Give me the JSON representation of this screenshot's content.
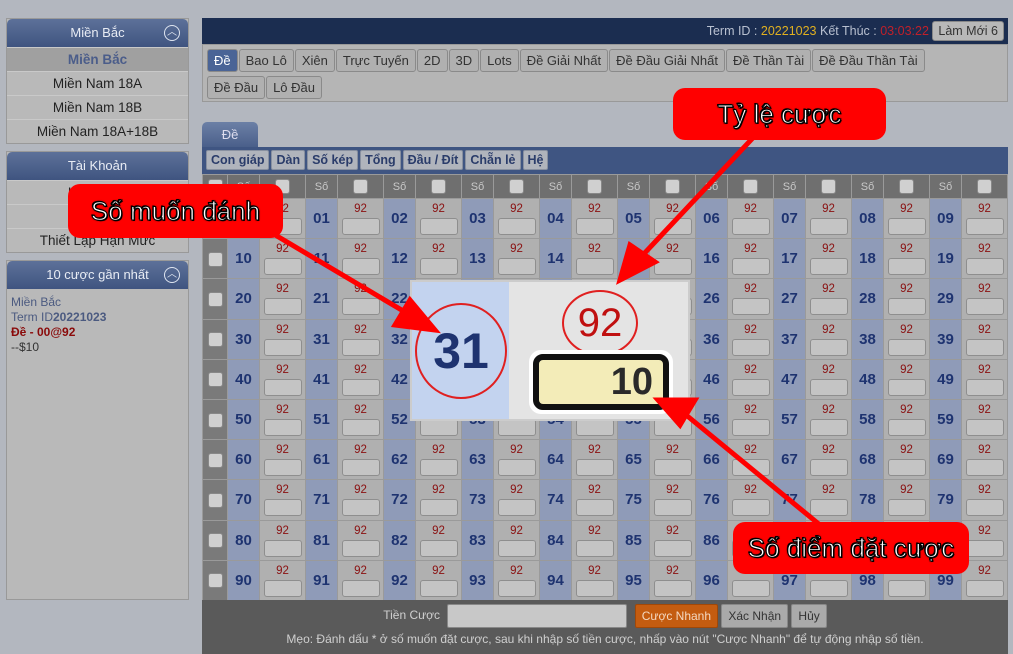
{
  "sidebar": {
    "region": {
      "title": "Miền Bắc",
      "items": [
        "Miền Bắc",
        "Miền Nam 18A",
        "Miền Nam 18B",
        "Miền Nam 18A+18B"
      ]
    },
    "account": {
      "title": "Tài Khoản",
      "items": [
        "Luật Chơi",
        "Báo Cáo",
        "Thiết Lập Hạn Mức"
      ]
    },
    "recent": {
      "title": "10 cược gần nhất",
      "region": "Miền Bắc",
      "term_label": "Term ID",
      "term": "20221023",
      "bet": "Đề - 00@92",
      "amount": "--$10"
    }
  },
  "topbar": {
    "term_label": "Term ID :",
    "term": "20221023",
    "end_label": "Kết Thúc :",
    "time": "03:03:22",
    "refresh": "Làm Mới 6"
  },
  "game_tabs": [
    "Đề",
    "Bao Lô",
    "Xiên",
    "Trực Tuyến",
    "2D",
    "3D",
    "Lots",
    "Đề Giải Nhất",
    "Đề Đầu Giải Nhất",
    "Đề Thần Tài",
    "Đề Đầu Thần Tài",
    "Đề Đầu",
    "Lô Đầu"
  ],
  "active_game_tab": "Đề",
  "sub_tab": "Đề",
  "filters": [
    "Con giáp",
    "Dàn",
    "Số kép",
    "Tổng",
    "Đầu / Đít",
    "Chẵn lẻ",
    "Hệ"
  ],
  "grid": {
    "header_label": "Số",
    "numbers": [
      [
        "00",
        "01",
        "02",
        "03",
        "04",
        "05",
        "06",
        "07",
        "08",
        "09"
      ],
      [
        "10",
        "11",
        "12",
        "13",
        "14",
        "15",
        "16",
        "17",
        "18",
        "19"
      ],
      [
        "20",
        "21",
        "22",
        "23",
        "24",
        "25",
        "26",
        "27",
        "28",
        "29"
      ],
      [
        "30",
        "31",
        "32",
        "33",
        "34",
        "35",
        "36",
        "37",
        "38",
        "39"
      ],
      [
        "40",
        "41",
        "42",
        "43",
        "44",
        "45",
        "46",
        "47",
        "48",
        "49"
      ],
      [
        "50",
        "51",
        "52",
        "53",
        "54",
        "55",
        "56",
        "57",
        "58",
        "59"
      ],
      [
        "60",
        "61",
        "62",
        "63",
        "64",
        "65",
        "66",
        "67",
        "68",
        "69"
      ],
      [
        "70",
        "71",
        "72",
        "73",
        "74",
        "75",
        "76",
        "77",
        "78",
        "79"
      ],
      [
        "80",
        "81",
        "82",
        "83",
        "84",
        "85",
        "86",
        "87",
        "88",
        "89"
      ],
      [
        "90",
        "91",
        "92",
        "93",
        "94",
        "95",
        "96",
        "97",
        "98",
        "99"
      ]
    ],
    "odds": [
      [
        "92",
        "92",
        "92",
        "92",
        "92",
        "92",
        "92",
        "92",
        "92",
        "92"
      ],
      [
        "92",
        "92",
        "92",
        "92",
        "92",
        "92",
        "92",
        "92",
        "92",
        "92"
      ],
      [
        "92",
        "92",
        "92",
        "92",
        "92",
        "92",
        "92",
        "92",
        "92",
        "92"
      ],
      [
        "92",
        "92",
        "92",
        "92",
        "92",
        "92",
        "92",
        "92",
        "92",
        "92"
      ],
      [
        "92",
        "92",
        "92",
        "92",
        "92",
        "92",
        "92",
        "92",
        "92",
        "92"
      ],
      [
        "92",
        "92",
        "92",
        "92",
        "92",
        "92",
        "92",
        "92",
        "92",
        "92"
      ],
      [
        "92",
        "92",
        "92",
        "92",
        "92",
        "92",
        "92",
        "92",
        "92",
        "92"
      ],
      [
        "92",
        "92",
        "92",
        "92",
        "92",
        "92",
        "92",
        "92",
        "92",
        "92"
      ],
      [
        "92",
        "92",
        "92",
        "92",
        "92",
        "92",
        "92",
        "92",
        "92",
        "92"
      ],
      [
        "92",
        "92",
        "92",
        "92",
        "92",
        "92",
        "92",
        "92",
        "92",
        "92"
      ]
    ]
  },
  "bottom": {
    "amount_label": "Tiền Cược",
    "amount_value": "",
    "quick": "Cược Nhanh",
    "confirm": "Xác Nhận",
    "cancel": "Hủy",
    "tip": "Mẹo: Đánh dấu * ở số muốn đặt cược, sau khi nhập số tiền cược, nhấp vào nút \"Cược Nhanh\" để tự động nhập số tiền."
  },
  "popup": {
    "number": "31",
    "odds": "92",
    "stake": "10"
  },
  "annotations": {
    "number": "Số muốn đánh",
    "odds": "Tỷ lệ cược",
    "stake": "Số điểm đặt cược"
  },
  "colors": {
    "header": "#1b2d50",
    "accent": "#c45c10",
    "annotation": "#ff0000",
    "number_text": "#1e3370",
    "odds_text": "#8a1010"
  }
}
